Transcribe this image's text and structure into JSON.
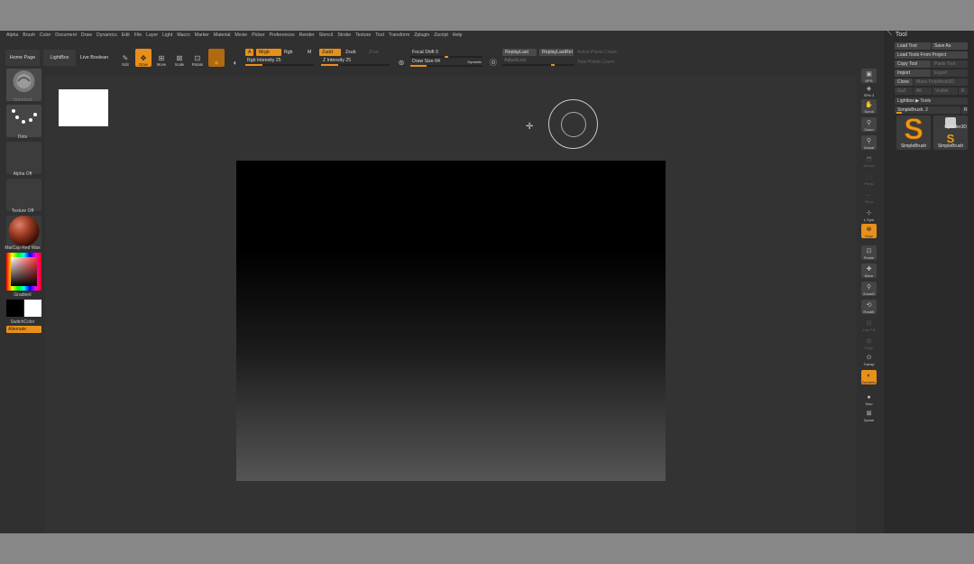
{
  "menu": [
    "Alpha",
    "Brush",
    "Color",
    "Document",
    "Draw",
    "Dynamics",
    "Edit",
    "File",
    "Layer",
    "Light",
    "Macro",
    "Marker",
    "Material",
    "Movie",
    "Picker",
    "Preferences",
    "Render",
    "Stencil",
    "Stroke",
    "Texture",
    "Tool",
    "Transform",
    "Zplugin",
    "Zscript",
    "Help"
  ],
  "toolbar": {
    "home_page": "Home Page",
    "lightbox": "LightBox",
    "live_boolean": "Live Boolean",
    "edit": "Edit",
    "draw": "Draw",
    "move": "Move",
    "scale": "Scale",
    "rotate": "Rotate",
    "a": "A",
    "mrgb": "Mrgb",
    "rgb": "Rgb",
    "m": "M",
    "zadd": "Zadd",
    "zsub": "Zsub",
    "zcut": "Zcut",
    "rgb_intensity": "Rgb Intensity 25",
    "z_intensity": "Z Intensity 25",
    "focal_shift": "Focal Shift 0",
    "draw_size": "Draw Size 64",
    "dynamic": "Dynamic",
    "replay_last": "ReplayLast",
    "replay_last_rel": "ReplayLastRel",
    "adjust_last": "AdjustLast",
    "active_points": "Active Points Count:",
    "total_points": "Total Points Count:"
  },
  "slider_values": {
    "rgb_intensity": 25,
    "z_intensity": 25,
    "focal_shift": 0,
    "draw_size": 64
  },
  "left_shelf": {
    "brush": "Standard",
    "stroke": "Dots",
    "alpha": "Alpha Off",
    "texture": "Texture Off",
    "material": "MatCap Red Wax",
    "gradient": "Gradient",
    "switch_color": "SwitchColor",
    "alternate": "Alternate"
  },
  "right_shelf": [
    "BPR",
    "SPix 3",
    "Scroll",
    "Zoom",
    "Actual",
    "AAHalf",
    "Persp",
    "Floor",
    "L.Sym",
    "Gxyz",
    "Frame",
    "Move",
    "ZoomD",
    "RotatE",
    "Line Fill",
    "PolyF",
    "Transp",
    "Dynamic",
    "Solo",
    "Xpose"
  ],
  "tool_panel": {
    "title": "Tool",
    "load_tool": "Load Tool",
    "save_as": "Save As",
    "load_from_project": "Load Tools From Project",
    "copy_tool": "Copy Tool",
    "paste_tool": "Paste Tool",
    "import": "Import",
    "export": "Export",
    "clone": "Clone",
    "make_polymesh": "Make PolyMesh3D",
    "goz": "GoZ",
    "all": "All",
    "visible": "Visible",
    "r": "R",
    "lightbox_tools": "Lightbox ▶ Tools",
    "simplebrush_count": "SimpleBrush. 2",
    "r2": "R",
    "thumb1": "SimpleBrush",
    "thumb2_top": "Cylinder3D",
    "thumb2": "SimpleBrush"
  },
  "colors": {
    "accent": "#e8901a",
    "bg": "#303030",
    "panel": "#2a2a2a"
  }
}
